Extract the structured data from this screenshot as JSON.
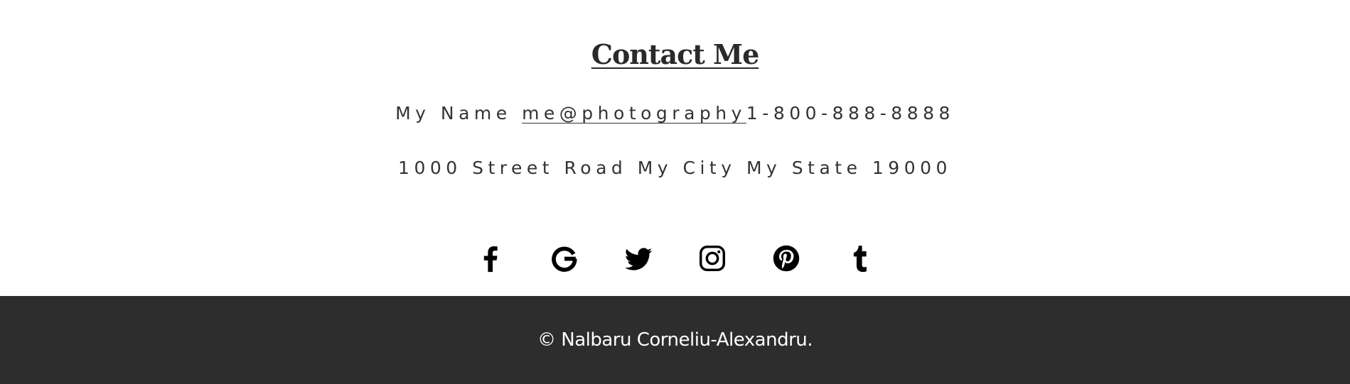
{
  "contact": {
    "title": "Contact Me",
    "name": "My Name ",
    "email": "me@photography",
    "phone": "1-800-888-8888",
    "address": "1000 Street Road My City My State 19000"
  },
  "social": {
    "icons": [
      "facebook-icon",
      "google-icon",
      "twitter-icon",
      "instagram-icon",
      "pinterest-icon",
      "tumblr-icon"
    ]
  },
  "footer": {
    "copyright": "© Nalbaru Corneliu-Alexandru."
  },
  "colors": {
    "text": "#333333",
    "icon": "#000000",
    "footer_bg": "#2d2d2d",
    "footer_text": "#ffffff"
  }
}
